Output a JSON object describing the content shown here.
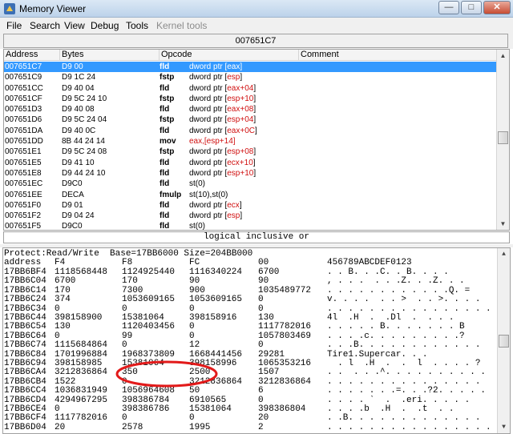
{
  "window": {
    "title": "Memory Viewer",
    "minimize": "—",
    "maximize": "□",
    "close": "✕"
  },
  "menu": [
    "File",
    "Search",
    "View",
    "Debug",
    "Tools",
    "Kernel tools"
  ],
  "address_bar": {
    "value": "007651C7"
  },
  "disassembly": {
    "columns": [
      "Address",
      "Bytes",
      "Opcode",
      "Comment"
    ],
    "rows": [
      {
        "addr": "007651C7",
        "bytes": "D9 00",
        "op": "fld",
        "pre": "dword ptr [",
        "reg": "eax",
        "post": "]"
      },
      {
        "addr": "007651C9",
        "bytes": "D9 1C 24",
        "op": "fstp",
        "pre": "dword ptr [",
        "reg": "esp",
        "post": "]"
      },
      {
        "addr": "007651CC",
        "bytes": "D9 40 04",
        "op": "fld",
        "pre": "dword ptr [",
        "reg": "eax+04",
        "post": "]"
      },
      {
        "addr": "007651CF",
        "bytes": "D9 5C 24 10",
        "op": "fstp",
        "pre": "dword ptr [",
        "reg": "esp+10",
        "post": "]"
      },
      {
        "addr": "007651D3",
        "bytes": "D9 40 08",
        "op": "fld",
        "pre": "dword ptr [",
        "reg": "eax+08",
        "post": "]"
      },
      {
        "addr": "007651D6",
        "bytes": "D9 5C 24 04",
        "op": "fstp",
        "pre": "dword ptr [",
        "reg": "esp+04",
        "post": "]"
      },
      {
        "addr": "007651DA",
        "bytes": "D9 40 0C",
        "op": "fld",
        "pre": "dword ptr [",
        "reg": "eax+0C",
        "post": "]"
      },
      {
        "addr": "007651DD",
        "bytes": "8B 44 24 14",
        "op": "mov",
        "pre": "",
        "reg": "eax,[esp+14]",
        "post": ""
      },
      {
        "addr": "007651E1",
        "bytes": "D9 5C 24 08",
        "op": "fstp",
        "pre": "dword ptr [",
        "reg": "esp+08",
        "post": "]"
      },
      {
        "addr": "007651E5",
        "bytes": "D9 41 10",
        "op": "fld",
        "pre": "dword ptr [",
        "reg": "ecx+10",
        "post": "]"
      },
      {
        "addr": "007651E8",
        "bytes": "D9 44 24 10",
        "op": "fld",
        "pre": "dword ptr [",
        "reg": "esp+10",
        "post": "]"
      },
      {
        "addr": "007651EC",
        "bytes": "D9C0",
        "op": "fld",
        "pre": "st(0)",
        "reg": "",
        "post": ""
      },
      {
        "addr": "007651EE",
        "bytes": "DECA",
        "op": "fmulp",
        "pre": "st(10),st(0)",
        "reg": "",
        "post": ""
      },
      {
        "addr": "007651F0",
        "bytes": "D9 01",
        "op": "fld",
        "pre": "dword ptr [",
        "reg": "ecx",
        "post": "]"
      },
      {
        "addr": "007651F2",
        "bytes": "D9 04 24",
        "op": "fld",
        "pre": "dword ptr [",
        "reg": "esp",
        "post": "]"
      },
      {
        "addr": "007651F5",
        "bytes": "D9C0",
        "op": "fld",
        "pre": "st(0)",
        "reg": "",
        "post": ""
      }
    ]
  },
  "status_line": "logical inclusive or",
  "hex_view": {
    "info": "Protect:Read/Write  Base=17BB6000 Size=204BB000",
    "columns": [
      "address",
      "F4",
      "F8",
      "FC",
      "00",
      "456789ABCDEF0123"
    ],
    "rows": [
      [
        "17BB6BF4",
        "1118568448",
        "1124925440",
        "1116340224",
        "6700",
        ". . B. . .C. . B. . . ."
      ],
      [
        "17BB6C04",
        "6700",
        "170",
        "90",
        "90",
        ", . . .  . . .Z. . .Z. . ."
      ],
      [
        "17BB6C14",
        "170",
        "7300",
        "900",
        "1035489772",
        ". . . . . . . . . . . .Q. ="
      ],
      [
        "17BB6C24",
        "374",
        "1053609165",
        "1053609165",
        "0",
        "v. . . .  . . >  . . >. . . ."
      ],
      [
        "17BB6C34",
        "0",
        "0",
        "0",
        "0",
        ". . . . . . . . . . . . . . . ."
      ],
      [
        "17BB6C44",
        "398158900",
        "15381064",
        "398158916",
        "130",
        "4l  .H  .  .Dl  .  . . ."
      ],
      [
        "17BB6C54",
        "130",
        "1120403456",
        "0",
        "1117782016",
        ". . . . . B. . . . . . . B"
      ],
      [
        "17BB6C64",
        "0",
        "99",
        "0",
        "1057803469",
        ". . . .c. . . . . . . . .?"
      ],
      [
        "17BB6C74",
        "1115684864",
        "0",
        "12",
        "0",
        ". . .B. . . . . . . . . . . ."
      ],
      [
        "17BB6C84",
        "1701996884",
        "1968373809",
        "1668441456",
        "29281",
        "Tire1.Supercar. . ."
      ],
      [
        "17BB6C94",
        "398158985",
        "15381064",
        "398158996",
        "1065353216",
        "  . l  .H  .  .  l  . . . . ?"
      ],
      [
        "17BB6CA4",
        "3212836864",
        "350",
        "2500",
        "1507",
        ". .  . . .^. . . . . . . . . ."
      ],
      [
        "17BB6CB4",
        "1522",
        "0",
        "3212836864",
        "3212836864",
        ". . . . . . . . . . . . . . ."
      ],
      [
        "17BB6CC4",
        "1036831949",
        "1056964608",
        "50",
        "6",
        ". . . . . . .=. . .?2. . . . ."
      ],
      [
        "17BB6CD4",
        "4294967295",
        "398386784",
        "6910565",
        "0",
        ". . . . `  .  .eri. . . . ."
      ],
      [
        "17BB6CE4",
        "0",
        "398386786",
        "15381064",
        "398386804",
        ". . . .b  .H  .  .t  . ."
      ],
      [
        "17BB6CF4",
        "1117782016",
        "0",
        "0",
        "20",
        ". .B. . . . . . . . . . . . ."
      ],
      [
        "17BB6D04",
        "20",
        "2578",
        "1995",
        "2",
        ". . . . . . . . . . . . . . . ."
      ]
    ]
  },
  "colors": {
    "register": "#d01010",
    "annotation": "#e21a1a",
    "title_gradient": "#dbe8f5"
  },
  "icons": [
    "cheat-engine-icon",
    "minimize-icon",
    "maximize-icon",
    "close-icon",
    "scroll-up-icon",
    "scroll-down-icon"
  ]
}
